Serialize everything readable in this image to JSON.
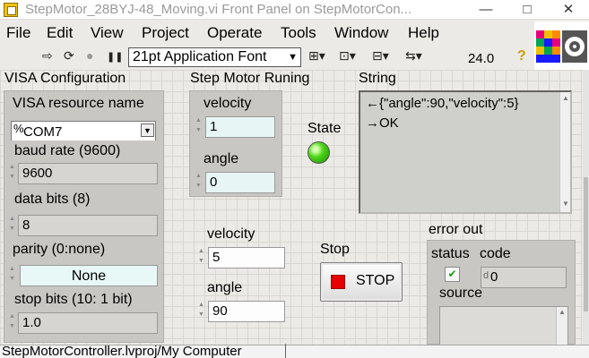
{
  "window": {
    "title": "StepMotor_28BYJ-48_Moving.vi Front Panel on StepMotorCon...",
    "minimize_glyph": "—",
    "maximize_glyph": "□",
    "close_glyph": "✕"
  },
  "menu": [
    "File",
    "Edit",
    "View",
    "Project",
    "Operate",
    "Tools",
    "Window",
    "Help"
  ],
  "toolbar": {
    "run_glyph": "⇨",
    "run_continuous_glyph": "⟳",
    "abort_glyph": "●",
    "pause_glyph": "❚❚",
    "font": "21pt Application Font",
    "align_glyph": "⊞▾",
    "distribute_glyph": "⊡▾",
    "resize_glyph": "⊟▾",
    "reorder_glyph": "⇆▾",
    "zoom": "24.0",
    "help_glyph": "?"
  },
  "visa": {
    "section_title": "VISA Configuration",
    "resource_label": "VISA resource name",
    "resource_prefix": "%",
    "resource_value": "COM7",
    "baud_label": "baud rate (9600)",
    "baud_value": "9600",
    "databits_label": "data bits (8)",
    "databits_value": "8",
    "parity_label": "parity (0:none)",
    "parity_value": "None",
    "stopbits_label": "stop bits (10: 1 bit)",
    "stopbits_value": "1.0"
  },
  "running": {
    "section_title": "Step Motor Runing",
    "velocity_label": "velocity",
    "velocity_value": "1",
    "angle_label": "angle",
    "angle_value": "0",
    "state_label": "State"
  },
  "string": {
    "label": "String",
    "line1": "←{\"angle\":90,\"velocity\":5}",
    "line2": "→OK"
  },
  "controls": {
    "velocity_label": "velocity",
    "velocity_value": "5",
    "angle_label": "angle",
    "angle_value": "90",
    "stop_label": "Stop",
    "stop_button": "STOP"
  },
  "error_out": {
    "label": "error out",
    "status_label": "status",
    "status_check": "✔",
    "code_label": "code",
    "code_prefix": "d",
    "code_value": "0",
    "source_label": "source"
  },
  "statusbar": {
    "project_path": "StepMotorController.lvproj/My Computer"
  },
  "colors": {
    "led_on": "#4ed51a",
    "stop_square": "#e60000",
    "panel_bg": "#eceae6"
  }
}
